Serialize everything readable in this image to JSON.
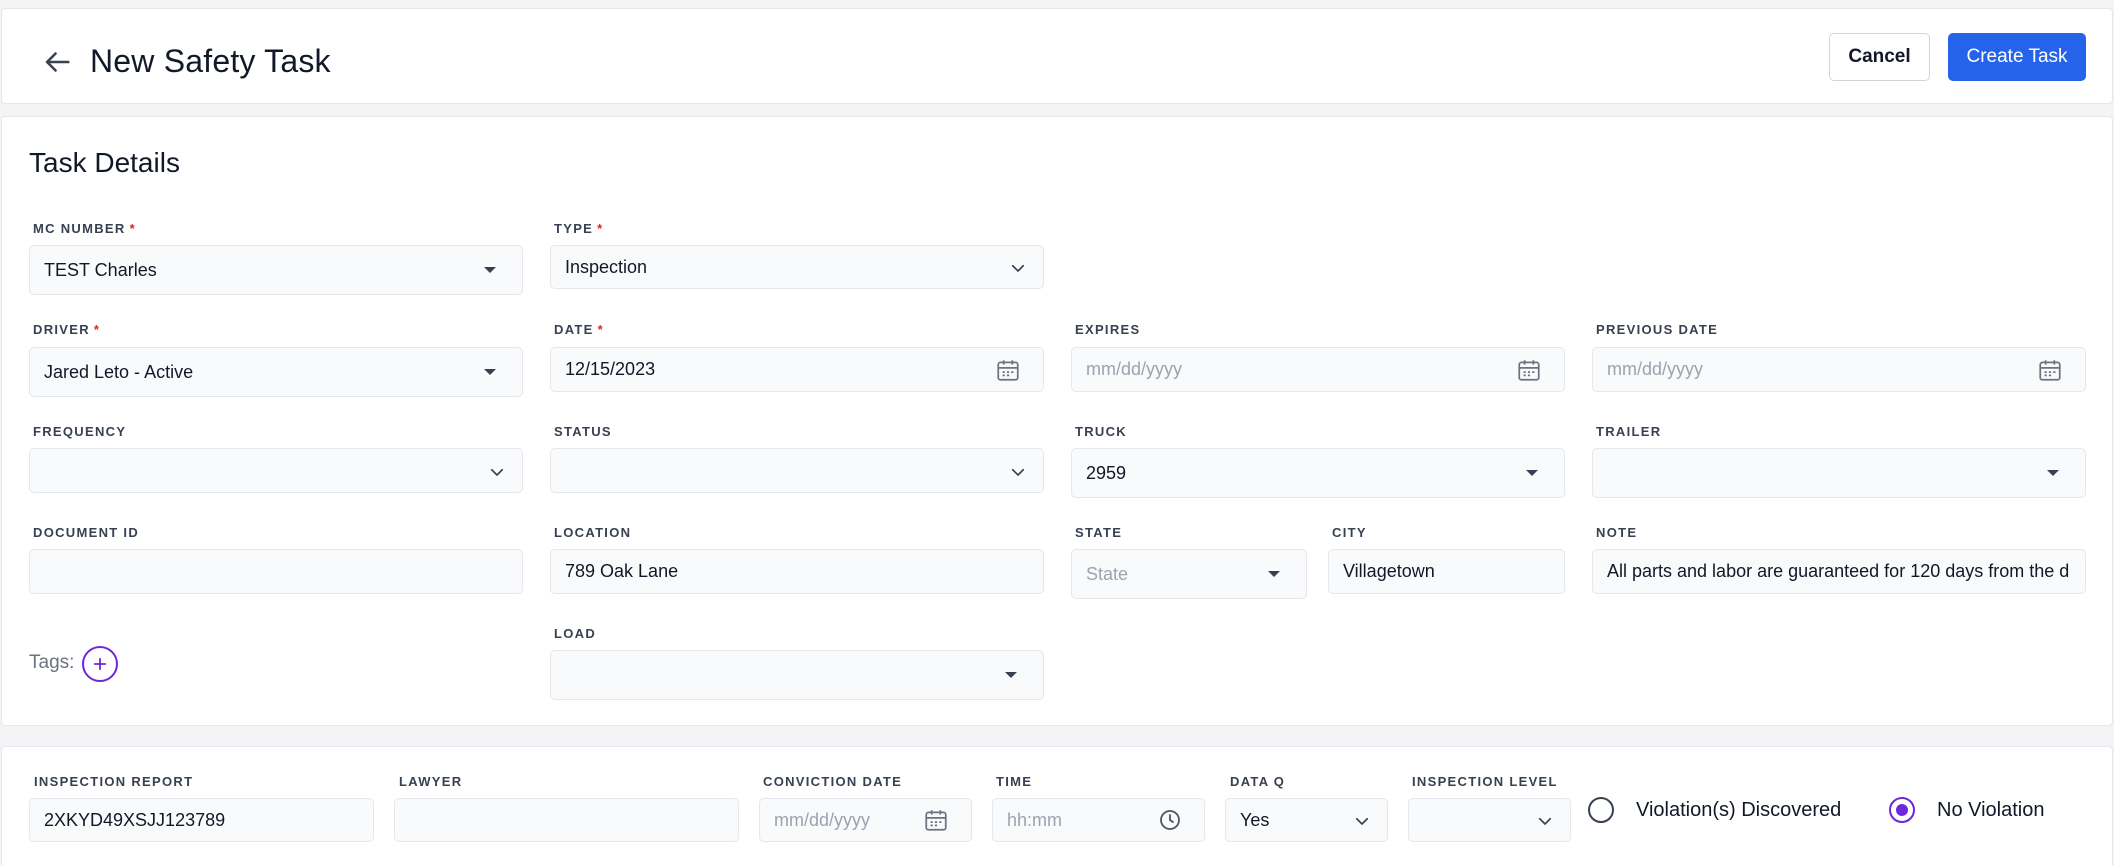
{
  "header": {
    "title": "New Safety Task",
    "cancel_label": "Cancel",
    "create_label": "Create Task"
  },
  "details": {
    "section_title": "Task Details",
    "required_mark": "*",
    "mc_number": {
      "label": "MC NUMBER",
      "value": "TEST Charles"
    },
    "type": {
      "label": "TYPE",
      "value": "Inspection"
    },
    "driver": {
      "label": "DRIVER",
      "value": "Jared Leto - Active"
    },
    "date": {
      "label": "DATE",
      "value": "12/15/2023"
    },
    "expires": {
      "label": "EXPIRES",
      "placeholder": "mm/dd/yyyy"
    },
    "previous_date": {
      "label": "PREVIOUS DATE",
      "placeholder": "mm/dd/yyyy"
    },
    "frequency": {
      "label": "FREQUENCY",
      "value": ""
    },
    "status": {
      "label": "STATUS",
      "value": ""
    },
    "truck": {
      "label": "TRUCK",
      "value": "2959"
    },
    "trailer": {
      "label": "TRAILER",
      "value": ""
    },
    "document_id": {
      "label": "DOCUMENT ID",
      "value": ""
    },
    "location": {
      "label": "LOCATION",
      "value": "789 Oak Lane"
    },
    "state": {
      "label": "STATE",
      "placeholder": "State"
    },
    "city": {
      "label": "CITY",
      "value": "Villagetown"
    },
    "note": {
      "label": "NOTE",
      "value": "All parts and labor are guaranteed for 120 days from the d"
    },
    "tags": {
      "label": "Tags:"
    },
    "load": {
      "label": "LOAD",
      "value": ""
    }
  },
  "inspection": {
    "inspection_report": {
      "label": "INSPECTION REPORT",
      "value": "2XKYD49XSJJ123789"
    },
    "lawyer": {
      "label": "LAWYER",
      "value": ""
    },
    "conviction_date": {
      "label": "CONVICTION DATE",
      "placeholder": "mm/dd/yyyy"
    },
    "time": {
      "label": "TIME",
      "placeholder": "hh:mm"
    },
    "data_q": {
      "label": "DATA Q",
      "value": "Yes"
    },
    "inspection_level": {
      "label": "INSPECTION LEVEL",
      "value": ""
    },
    "violation_option": {
      "label": "Violation(s) Discovered",
      "checked": false
    },
    "no_violation_option": {
      "label": "No Violation",
      "checked": true
    }
  },
  "colors": {
    "accent": "#2563eb",
    "radio_accent": "#6d28d9",
    "required": "#dc2626",
    "page_bg": "#f3f4f6"
  },
  "icons": [
    "back-arrow-icon",
    "chevron-down-icon",
    "caret-down-icon",
    "calendar-icon",
    "clock-icon",
    "plus-icon"
  ]
}
